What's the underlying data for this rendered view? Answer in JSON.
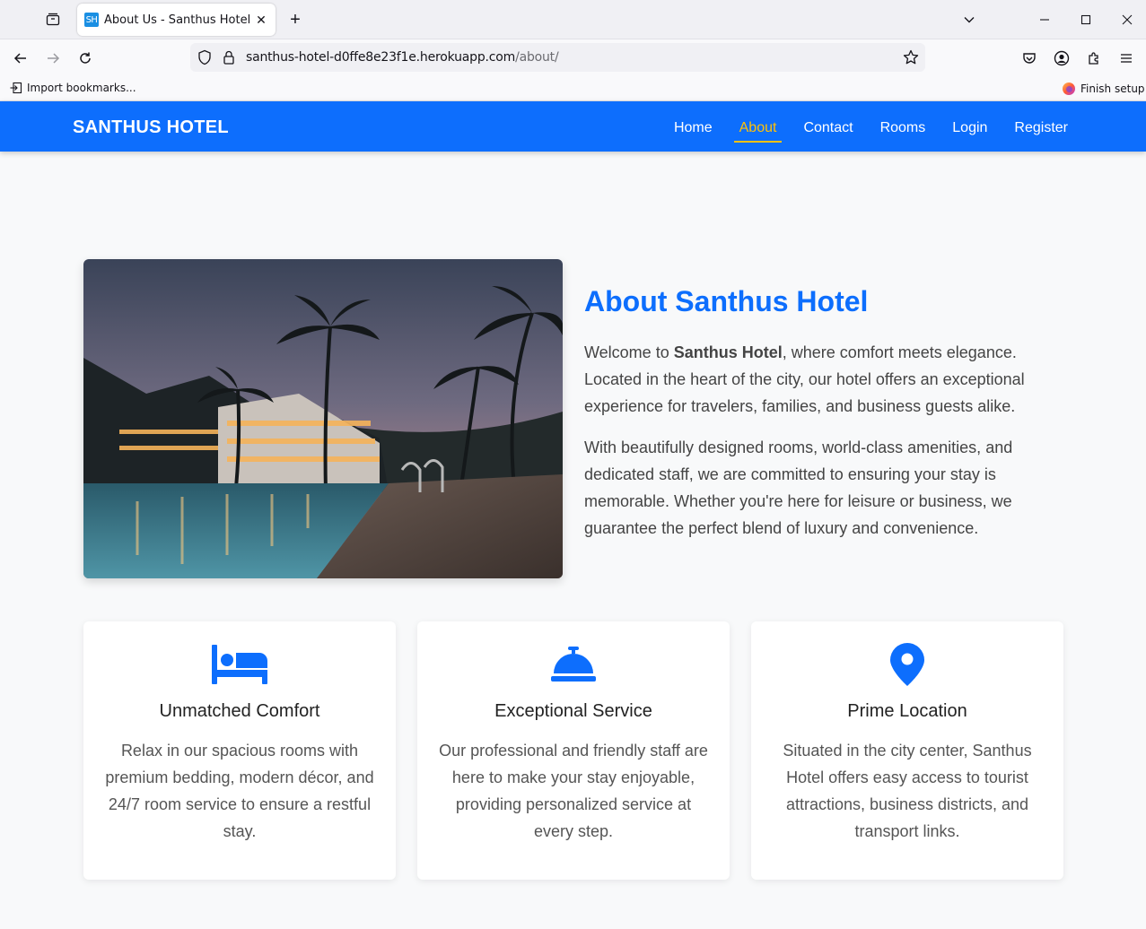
{
  "browser": {
    "tab_title": "About Us - Santhus Hotel",
    "tab_favicon": "SH",
    "url_host": "santhus-hotel-d0ffe8e23f1e.herokuapp.com",
    "url_path": "/about/",
    "bookmark_import": "Import bookmarks...",
    "finish_setup": "Finish setup"
  },
  "site": {
    "brand": "SANTHUS HOTEL",
    "menu": [
      {
        "label": "Home"
      },
      {
        "label": "About",
        "active": true
      },
      {
        "label": "Contact"
      },
      {
        "label": "Rooms"
      },
      {
        "label": "Login"
      },
      {
        "label": "Register"
      }
    ]
  },
  "about": {
    "title": "About Santhus Hotel",
    "p1_before": "Welcome to ",
    "p1_bold": "Santhus Hotel",
    "p1_after": ", where comfort meets elegance. Located in the heart of the city, our hotel offers an exceptional experience for travelers, families, and business guests alike.",
    "p2": "With beautifully designed rooms, world-class amenities, and dedicated staff, we are committed to ensuring your stay is memorable. Whether you're here for leisure or business, we guarantee the perfect blend of luxury and convenience."
  },
  "features": [
    {
      "icon": "bed-icon",
      "title": "Unmatched Comfort",
      "text": "Relax in our spacious rooms with premium bedding, modern décor, and 24/7 room service to ensure a restful stay."
    },
    {
      "icon": "service-bell-icon",
      "title": "Exceptional Service",
      "text": "Our professional and friendly staff are here to make your stay enjoyable, providing personalized service at every step."
    },
    {
      "icon": "map-pin-icon",
      "title": "Prime Location",
      "text": "Situated in the city center, Santhus Hotel offers easy access to tourist attractions, business districts, and transport links."
    }
  ],
  "colors": {
    "primary": "#0d6efd",
    "active": "#ffc107",
    "background": "#f8f9fa"
  }
}
